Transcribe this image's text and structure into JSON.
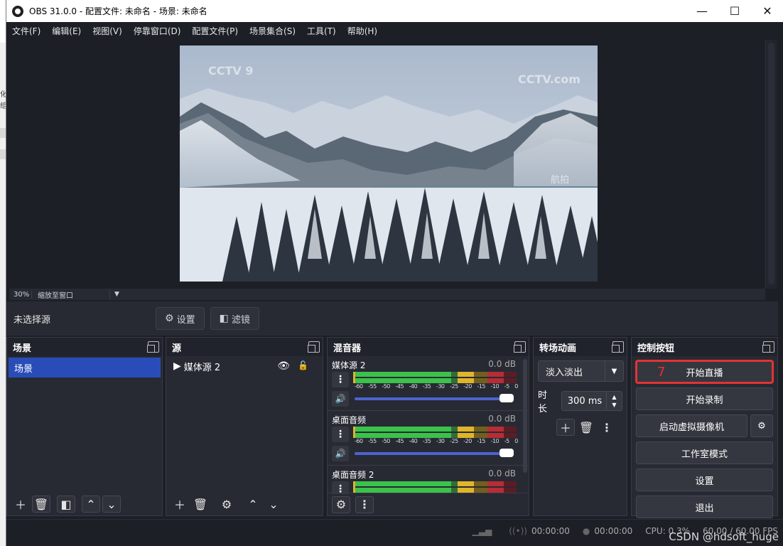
{
  "window": {
    "title": "OBS 31.0.0 - 配置文件: 未命名 - 场景: 未命名",
    "controls": [
      "—",
      "☐",
      "✕"
    ]
  },
  "menu": [
    "文件(F)",
    "编辑(E)",
    "视图(V)",
    "停靠窗口(D)",
    "配置文件(P)",
    "场景集合(S)",
    "工具(T)",
    "帮助(H)"
  ],
  "preview": {
    "zoom": "30%",
    "zoom_mode": "缩放至窗口"
  },
  "source_bar": {
    "no_selection": "未选择源",
    "settings": "设置",
    "filters": "滤镜"
  },
  "scenes": {
    "title": "场景",
    "items": [
      "场景"
    ]
  },
  "sources": {
    "title": "源",
    "items": [
      "媒体源 2"
    ]
  },
  "mixer": {
    "title": "混音器",
    "channels": [
      {
        "name": "媒体源 2",
        "db": "0.0 dB"
      },
      {
        "name": "桌面音频",
        "db": "0.0 dB"
      },
      {
        "name": "桌面音频 2",
        "db": "0.0 dB"
      }
    ],
    "ticks": [
      "-60",
      "-55",
      "-50",
      "-45",
      "-40",
      "-35",
      "-30",
      "-25",
      "-20",
      "-15",
      "-10",
      "-5",
      "0"
    ]
  },
  "transitions": {
    "title": "转场动画",
    "selected": "淡入淡出",
    "duration_label": "时长",
    "duration_value": "300 ms"
  },
  "controls": {
    "title": "控制按钮",
    "annotation": "7",
    "start_stream": "开始直播",
    "start_record": "开始录制",
    "virtual_cam": "启动虚拟摄像机",
    "studio_mode": "工作室模式",
    "settings": "设置",
    "exit": "退出"
  },
  "status": {
    "stream_time": "00:00:00",
    "record_time": "00:00:00",
    "cpu": "CPU: 0.3%",
    "fps": "60.00 / 60.00 FPS"
  },
  "watermark": "CSDN @hdsoft_huge",
  "overlay_text": {
    "channel_logo": "CCTV 9",
    "channel_logo_right": "CCTV.com",
    "caption": "航拍"
  },
  "ghost_text": [
    "化",
    "组"
  ]
}
